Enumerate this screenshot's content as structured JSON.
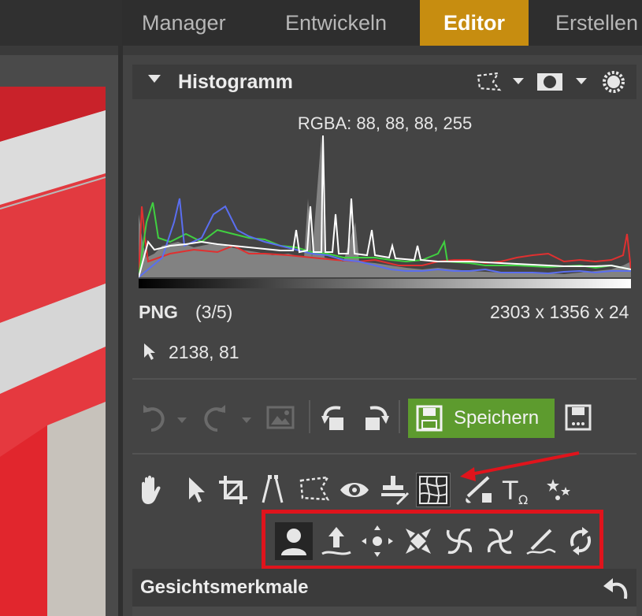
{
  "modules": {
    "tabs": [
      {
        "label": "Manager",
        "active": false
      },
      {
        "label": "Entwickeln",
        "active": false
      },
      {
        "label": "Editor",
        "active": true
      },
      {
        "label": "Erstellen",
        "active": false
      }
    ]
  },
  "histogram": {
    "title": "Histogramm",
    "rgba_readout": "RGBA:  88,  88,  88, 255",
    "header_icons": [
      "selection-icon",
      "dropdown-icon",
      "mask-icon",
      "dropdown-icon",
      "settings-icon"
    ]
  },
  "file_info": {
    "format": "PNG",
    "index": "(3/5)",
    "dimensions": "2303 x 1356 x 24",
    "cursor_position": "2138, 81"
  },
  "toolbar": {
    "save_label": "Speichern",
    "icons": [
      "undo-icon",
      "redo-icon",
      "image-icon",
      "rotate-left-icon",
      "rotate-right-icon",
      "save-icon",
      "save-as-icon"
    ]
  },
  "tools": {
    "icons": [
      "hand-icon",
      "pointer-icon",
      "crop-icon",
      "straighten-icon",
      "selection-icon",
      "red-eye-icon",
      "stamp-icon",
      "liquify-icon",
      "brush-icon",
      "text-icon",
      "effects-icon"
    ],
    "active": "liquify-icon"
  },
  "liquify_tools": {
    "icons": [
      "face-features-icon",
      "push-icon",
      "expand-icon",
      "shrink-icon",
      "twirl-right-icon",
      "twirl-left-icon",
      "smudge-icon",
      "reset-icon"
    ],
    "active": "face-features-icon"
  },
  "section": {
    "title": "Gesichtsmerkmale"
  },
  "colors": {
    "accent": "#c78d10",
    "save_green": "#5d9b2e",
    "highlight_red": "#e0141c"
  }
}
